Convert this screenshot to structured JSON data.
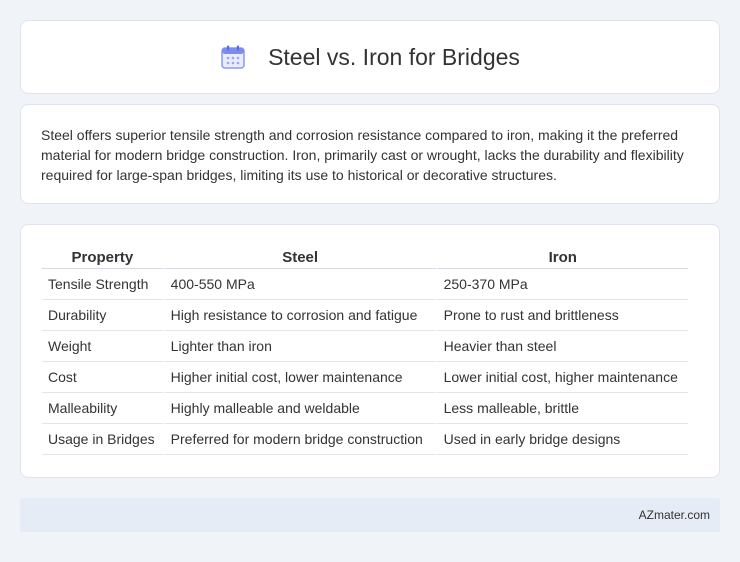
{
  "header": {
    "title": "Steel vs. Iron for Bridges",
    "icon": "calendar-icon",
    "icon_color": "#7b8cf0"
  },
  "summary": {
    "text": "Steel offers superior tensile strength and corrosion resistance compared to iron, making it the preferred material for modern bridge construction. Iron, primarily cast or wrought, lacks the durability and flexibility required for large-span bridges, limiting its use to historical or decorative structures."
  },
  "table": {
    "headers": [
      "Property",
      "Steel",
      "Iron"
    ],
    "rows": [
      [
        "Tensile Strength",
        "400-550 MPa",
        "250-370 MPa"
      ],
      [
        "Durability",
        "High resistance to corrosion and fatigue",
        "Prone to rust and brittleness"
      ],
      [
        "Weight",
        "Lighter than iron",
        "Heavier than steel"
      ],
      [
        "Cost",
        "Higher initial cost, lower maintenance",
        "Lower initial cost, higher maintenance"
      ],
      [
        "Malleability",
        "Highly malleable and weldable",
        "Less malleable, brittle"
      ],
      [
        "Usage in Bridges",
        "Preferred for modern bridge construction",
        "Used in early bridge designs"
      ]
    ]
  },
  "footer": {
    "text": "AZmater.com"
  }
}
